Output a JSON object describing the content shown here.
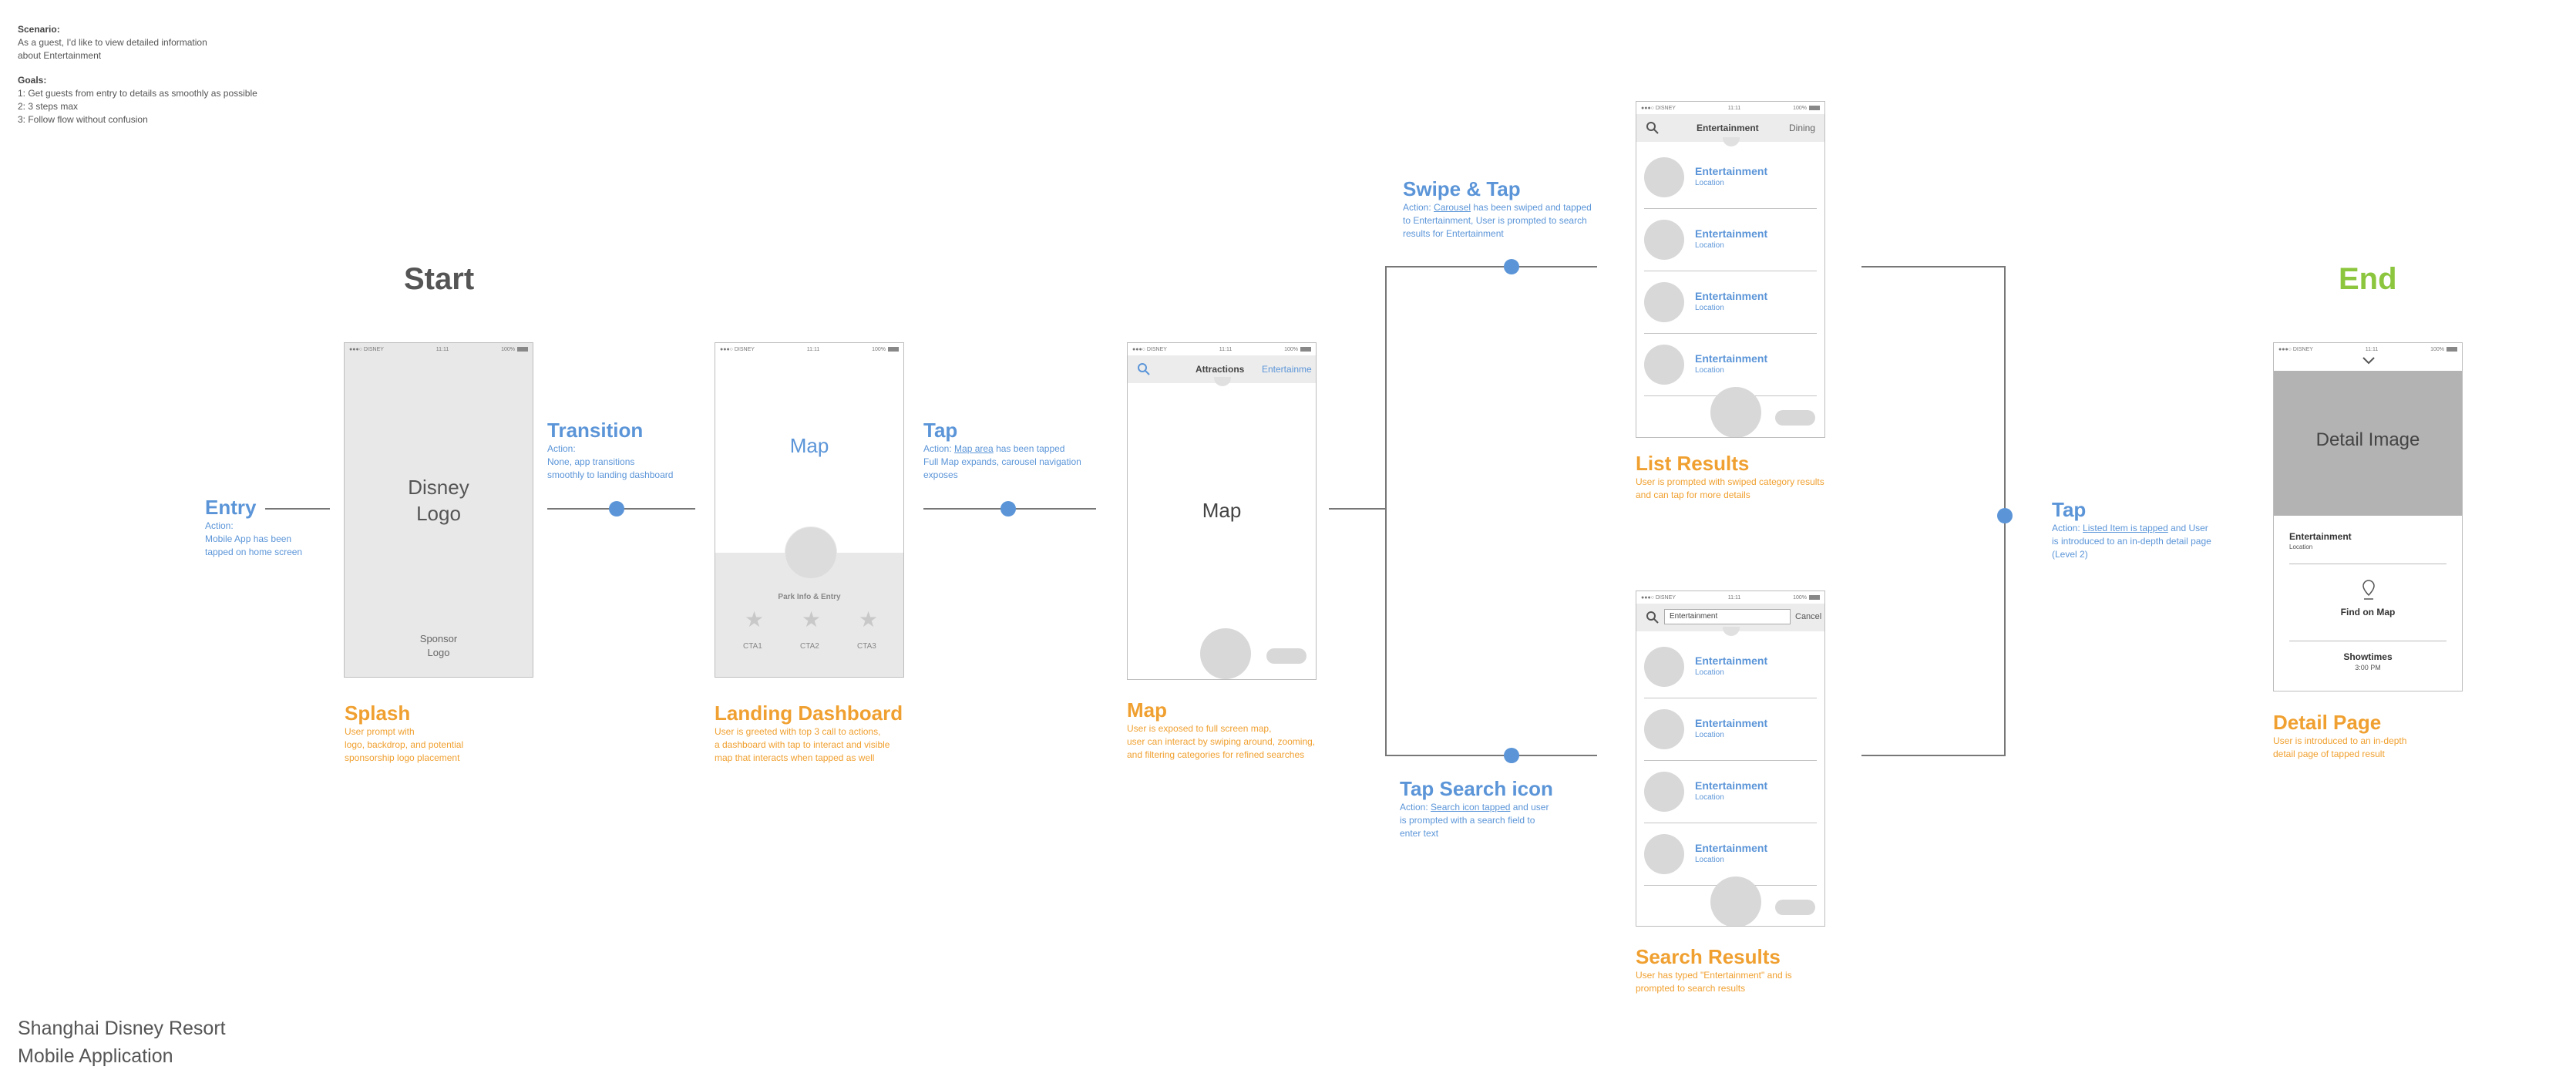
{
  "scenario": {
    "label": "Scenario:",
    "line1": "As a guest, I'd like to view detailed information",
    "line2": "about Entertainment"
  },
  "goals": {
    "label": "Goals:",
    "items": [
      "1: Get guests from entry to details as smoothly as possible",
      "2: 3 steps max",
      "3: Follow flow without confusion"
    ]
  },
  "footer": {
    "line1": "Shanghai Disney Resort",
    "line2": "Mobile Application"
  },
  "start_label": "Start",
  "end_label": "End",
  "steps": {
    "entry": {
      "title": "Entry",
      "action": "Action:",
      "desc1": "Mobile App has been",
      "desc2": "tapped on home screen"
    },
    "transition": {
      "title": "Transition",
      "action": "Action:",
      "desc1": "None, app transitions",
      "desc2": "smoothly to landing dashboard"
    },
    "tap1": {
      "title": "Tap",
      "action_prefix": "Action: ",
      "action_link": "Map area",
      "action_rest": " has been tapped",
      "desc1": "Full Map expands, carousel navigation",
      "desc2": "exposes"
    },
    "swipe": {
      "title": "Swipe & Tap",
      "action_prefix": "Action: ",
      "action_link": "Carousel",
      "action_rest": " has been swiped and tapped",
      "desc1": "to Entertainment, User is prompted to search",
      "desc2": "results for Entertainment"
    },
    "search_tap": {
      "title": "Tap Search icon",
      "action_prefix": "Action: ",
      "action_link": "Search icon tapped",
      "action_rest": " and user",
      "desc1": "is prompted with a search field to",
      "desc2": "enter text"
    },
    "tap2": {
      "title": "Tap",
      "action_prefix": "Action: ",
      "action_link": "Listed Item is tapped",
      "action_rest": " and User",
      "desc1": "is introduced to an in-depth detail page",
      "desc2": "(Level 2)"
    }
  },
  "screens": {
    "splash": {
      "status": {
        "carrier": "●●●○ DISNEY",
        "time": "11:11",
        "battery": "100%"
      },
      "logo_line1": "Disney",
      "logo_line2": "Logo",
      "sponsor_line1": "Sponsor",
      "sponsor_line2": "Logo",
      "caption_title": "Splash",
      "caption_lines": [
        "User prompt with",
        "logo, backdrop, and potential",
        "sponsorship logo placement"
      ]
    },
    "landing": {
      "status": {
        "carrier": "●●●○ DISNEY",
        "time": "11:11",
        "battery": "100%"
      },
      "map_label": "Map",
      "park_info": "Park Info & Entry",
      "ctas": [
        "CTA1",
        "CTA2",
        "CTA3"
      ],
      "caption_title": "Landing Dashboard",
      "caption_lines": [
        "User is greeted with top 3 call to actions,",
        "a dashboard with tap to interact and visible",
        "map that interacts when tapped as well"
      ]
    },
    "map": {
      "status": {
        "carrier": "●●●○ DISNEY",
        "time": "11:11",
        "battery": "100%"
      },
      "tab_active": "Attractions",
      "tab_next": "Entertainme",
      "map_label": "Map",
      "caption_title": "Map",
      "caption_lines": [
        "User is exposed to full screen map,",
        "user can interact by swiping around, zooming,",
        "and filtering categories for refined searches"
      ]
    },
    "list": {
      "status": {
        "carrier": "●●●○ DISNEY",
        "time": "11:11",
        "battery": "100%"
      },
      "tab_active": "Entertainment",
      "tab_next": "Dining",
      "items": [
        {
          "title": "Entertainment",
          "location": "Location"
        },
        {
          "title": "Entertainment",
          "location": "Location"
        },
        {
          "title": "Entertainment",
          "location": "Location"
        },
        {
          "title": "Entertainment",
          "location": "Location"
        }
      ],
      "caption_title": "List Results",
      "caption_lines": [
        "User is prompted with swiped category results",
        "and can tap for more details"
      ]
    },
    "search": {
      "status": {
        "carrier": "●●●○ DISNEY",
        "time": "11:11",
        "battery": "100%"
      },
      "search_value": "Entertainment",
      "cancel_label": "Cancel",
      "items": [
        {
          "title": "Entertainment",
          "location": "Location"
        },
        {
          "title": "Entertainment",
          "location": "Location"
        },
        {
          "title": "Entertainment",
          "location": "Location"
        },
        {
          "title": "Entertainment",
          "location": "Location"
        }
      ],
      "caption_title": "Search Results",
      "caption_lines": [
        "User has typed \"Entertainment\" and is",
        "prompted to search results"
      ]
    },
    "detail": {
      "status": {
        "carrier": "●●●○ DISNEY",
        "time": "11:11",
        "battery": "100%"
      },
      "image_label": "Detail Image",
      "name": "Entertainment",
      "location": "Location",
      "find_map": "Find on Map",
      "showtimes": "Showtimes",
      "time": "3:00 PM",
      "caption_title": "Detail Page",
      "caption_lines": [
        "User is introduced to an in-depth",
        "detail page of tapped result"
      ]
    }
  },
  "colors": {
    "blue": "#5b95d8",
    "orange": "#f0a030",
    "green": "#8cc63f",
    "gray_text": "#555555"
  }
}
